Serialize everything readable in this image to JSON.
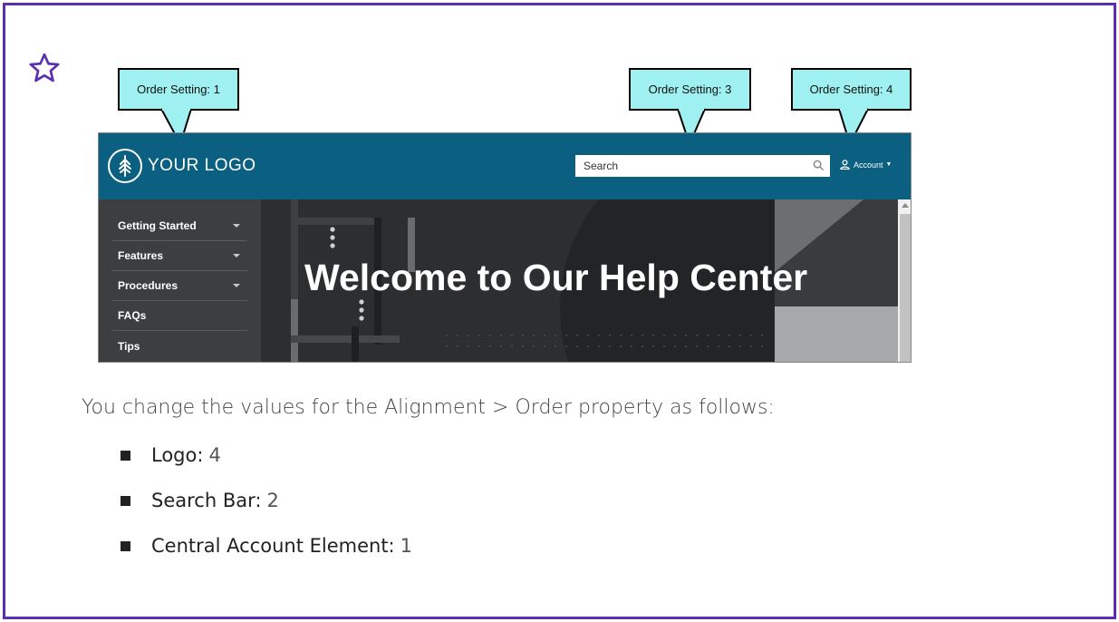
{
  "callouts": [
    {
      "label": "Order Setting: 1"
    },
    {
      "label": "Order Setting: 3"
    },
    {
      "label": "Order Setting: 4"
    }
  ],
  "screenshot": {
    "logo_text": "YOUR LOGO",
    "search_placeholder": "Search",
    "account_label": "Account",
    "menu": [
      "Getting Started",
      "Features",
      "Procedures",
      "FAQs",
      "Tips"
    ],
    "hero_title": "Welcome to Our Help Center"
  },
  "body": {
    "paragraph": "You change the values for the Alignment > Order property as follows:",
    "items": [
      {
        "label": "Logo:",
        "value": "4"
      },
      {
        "label": "Search Bar:",
        "value": "2"
      },
      {
        "label": "Central Account Element:",
        "value": "1"
      }
    ]
  },
  "colors": {
    "frame_border": "#5b2fb1",
    "callout_fill": "#9ff0f0",
    "header_bar": "#0b5f80",
    "sidebar": "#3d3e40"
  },
  "icons": [
    "star-icon",
    "logo-tree-icon",
    "search-icon",
    "person-icon"
  ]
}
